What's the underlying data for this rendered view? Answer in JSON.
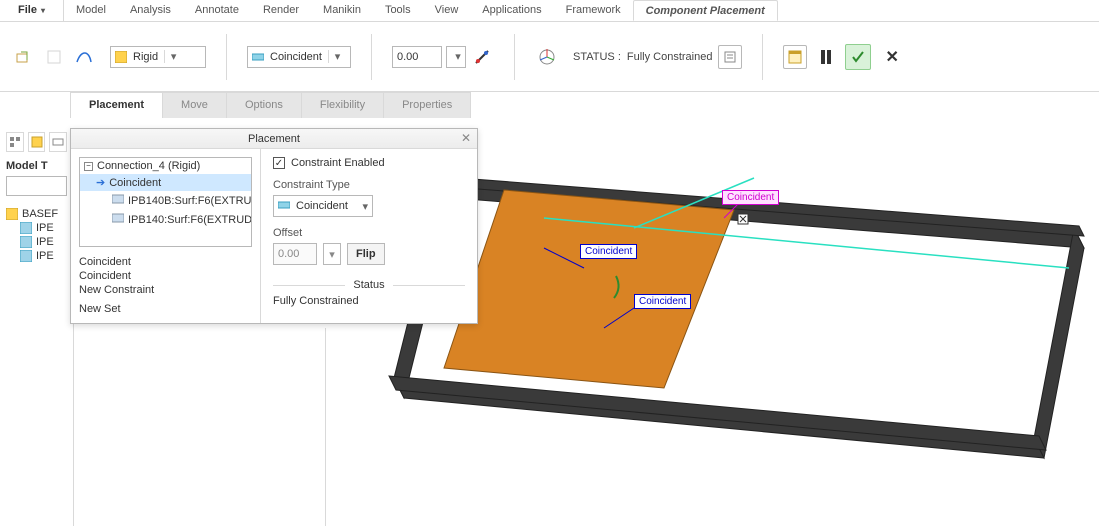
{
  "menubar": {
    "file": "File",
    "items": [
      "Model",
      "Analysis",
      "Annotate",
      "Render",
      "Manikin",
      "Tools",
      "View",
      "Applications",
      "Framework"
    ],
    "active": "Component Placement"
  },
  "ribbon": {
    "rigid_label": "Rigid",
    "coincident_label": "Coincident",
    "offset_value": "0.00",
    "status_prefix": "STATUS :",
    "status_value": "Fully Constrained"
  },
  "subtabs": [
    "Placement",
    "Move",
    "Options",
    "Flexibility",
    "Properties"
  ],
  "subtab_active_index": 0,
  "sidebar": {
    "title": "Model T",
    "search_placeholder": "",
    "root": "BASEF",
    "children": [
      "IPE",
      "IPE",
      "IPE"
    ]
  },
  "dialog": {
    "title": "Placement",
    "tree": {
      "root": "Connection_4 (Rigid)",
      "active": "Coincident",
      "refs": [
        "IPB140B:Surf:F6(EXTRU",
        "IPB140:Surf:F6(EXTRUD"
      ]
    },
    "list": [
      "Coincident",
      "Coincident",
      "New Constraint"
    ],
    "newset": "New Set",
    "right": {
      "constraint_enabled": "Constraint Enabled",
      "type_label": "Constraint Type",
      "type_value": "Coincident",
      "offset_label": "Offset",
      "offset_value": "0.00",
      "flip": "Flip",
      "status_label": "Status",
      "status_value": "Fully Constrained"
    }
  },
  "viewport": {
    "tags": {
      "top": "Coincident",
      "left": "Coincident",
      "bottom": "Coincident"
    }
  }
}
